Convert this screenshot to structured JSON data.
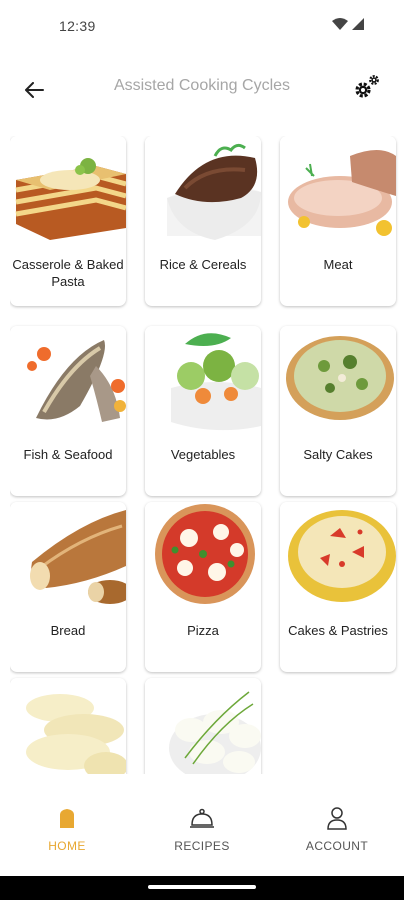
{
  "status_bar": {
    "time": "12:39"
  },
  "app_bar": {
    "title": "Assisted Cooking Cycles"
  },
  "categories": [
    {
      "label": "Casserole & Baked Pasta",
      "icon": "lasagna-image"
    },
    {
      "label": "Rice & Cereals",
      "icon": "rice-bowl-image"
    },
    {
      "label": "Meat",
      "icon": "roast-meat-image"
    },
    {
      "label": "Fish & Seafood",
      "icon": "fish-fillet-image"
    },
    {
      "label": "Vegetables",
      "icon": "vegetables-bowl-image"
    },
    {
      "label": "Salty Cakes",
      "icon": "quiche-image"
    },
    {
      "label": "Bread",
      "icon": "baguette-image"
    },
    {
      "label": "Pizza",
      "icon": "pizza-image"
    },
    {
      "label": "Cakes & Pastries",
      "icon": "tart-image"
    },
    {
      "label": "",
      "icon": "potatoes-image"
    },
    {
      "label": "",
      "icon": "eggs-image"
    }
  ],
  "bottom_nav": {
    "items": [
      {
        "label": "HOME",
        "icon": "home-icon",
        "active": true
      },
      {
        "label": "RECIPES",
        "icon": "cloche-icon",
        "active": false
      },
      {
        "label": "ACCOUNT",
        "icon": "person-icon",
        "active": false
      }
    ]
  },
  "colors": {
    "accent": "#e8a832",
    "title_gray": "#a6a6a6"
  }
}
